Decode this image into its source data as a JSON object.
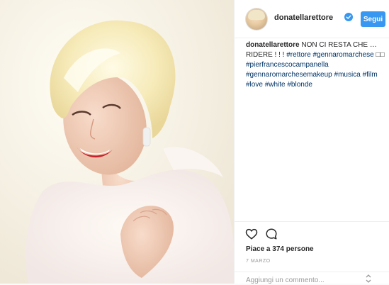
{
  "header": {
    "username": "donatellarettore",
    "follow_label": "Segui"
  },
  "caption": {
    "user": "donatellarettore",
    "text_parts": [
      {
        "text": "NON CI RESTA CHE … RIDERE ! ! ! ",
        "type": "text"
      },
      {
        "text": "#rettore",
        "type": "tag"
      },
      {
        "text": " ",
        "type": "text"
      },
      {
        "text": "#gennaromarchese",
        "type": "tag"
      },
      {
        "text": " □□ ",
        "type": "text"
      },
      {
        "text": "#pierfrancescocampanella",
        "type": "tag"
      },
      {
        "text": " ",
        "type": "text"
      },
      {
        "text": "#gennaromarchesemakeup",
        "type": "tag"
      },
      {
        "text": " ",
        "type": "text"
      },
      {
        "text": "#musica",
        "type": "tag"
      },
      {
        "text": " ",
        "type": "text"
      },
      {
        "text": "#film",
        "type": "tag"
      },
      {
        "text": " ",
        "type": "text"
      },
      {
        "text": "#love",
        "type": "tag"
      },
      {
        "text": " ",
        "type": "text"
      },
      {
        "text": "#white",
        "type": "tag"
      },
      {
        "text": " ",
        "type": "text"
      },
      {
        "text": "#blonde",
        "type": "tag"
      }
    ]
  },
  "actions": {
    "like_icon": "heart-icon",
    "comment_icon": "comment-icon",
    "likes_text": "Piace a 374 persone",
    "date": "7 MARZO"
  },
  "comment": {
    "placeholder": "Aggiungi un commento..."
  },
  "colors": {
    "accent": "#3897f0",
    "hashtag": "#003569",
    "verified": "#3897f0"
  }
}
